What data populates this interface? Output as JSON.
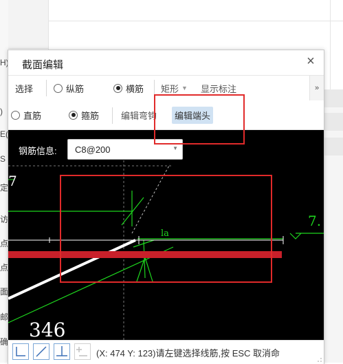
{
  "background": {
    "left_fragments": [
      "H)",
      ")",
      "E(",
      "S",
      "定",
      "访",
      "点",
      "点(",
      "面",
      "邮",
      "确"
    ]
  },
  "dialog": {
    "title": "截面编辑",
    "close_symbol": "×"
  },
  "toolbar1": {
    "select_label": "选择",
    "option_longitudinal": "纵筋",
    "option_transverse": "横筋",
    "transverse_selected": true,
    "rect_label": "矩形",
    "show_annotation_label": "显示标注",
    "more_symbol": "»"
  },
  "toolbar2": {
    "option_straight": "直筋",
    "option_stirrup": "箍筋",
    "stirrup_selected": true,
    "edit_hook_label": "编辑弯钩",
    "edit_end_label": "编辑端头"
  },
  "canvas": {
    "rebar_info_label": "钢筋信息:",
    "rebar_info_value": "C8@200",
    "dim_number": "346",
    "anchor_label": "la",
    "right_label": "7.",
    "left_label": "7"
  },
  "statusbar": {
    "coords_text": "(X: 474 Y: 123)请左键选择线筋,按 ESC 取消命"
  },
  "colors": {
    "canvas_bg": "#000000",
    "rebar_green": "#1ed61e",
    "beam_red": "#c8202a",
    "annotation_red": "#e12a2a",
    "active_button": "#d0e2f3"
  }
}
